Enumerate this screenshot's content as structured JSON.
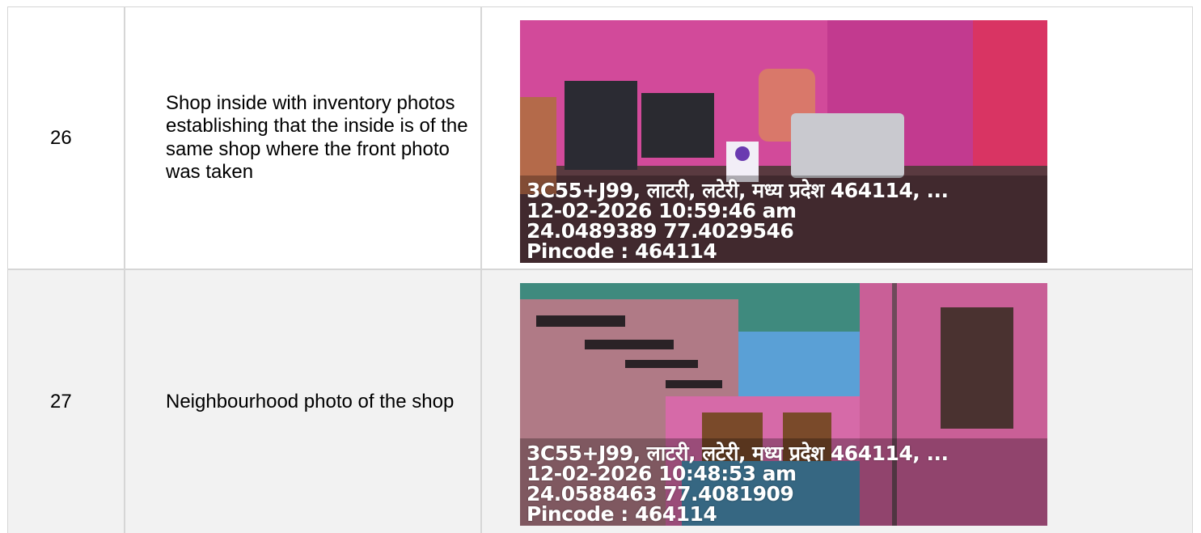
{
  "rows": [
    {
      "number": "26",
      "description": "Shop inside with inventory photos establishing that the inside is of the same shop where the front photo was taken",
      "photo": {
        "address": "3C55+J99, लाटरी, लटेरी, मध्य प्रदेश 464114, ...",
        "datetime": "12-02-2026 10:59:46 am",
        "coords": "24.0489389 77.4029546",
        "pincode": "Pincode : 464114"
      }
    },
    {
      "number": "27",
      "description": "Neighbourhood photo of the shop",
      "photo": {
        "address": "3C55+J99, लाटरी, लटेरी, मध्य प्रदेश 464114, ...",
        "datetime": "12-02-2026 10:48:53 am",
        "coords": "24.0588463 77.4081909",
        "pincode": "Pincode : 464114"
      }
    }
  ]
}
